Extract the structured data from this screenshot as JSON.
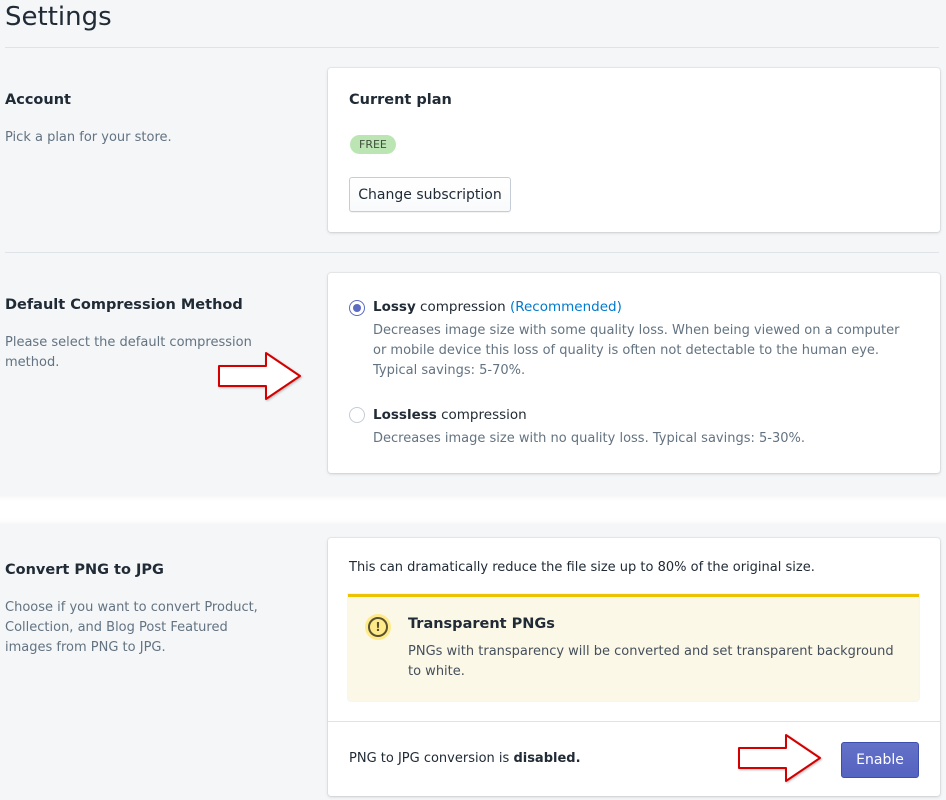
{
  "page": {
    "title": "Settings"
  },
  "account": {
    "title": "Account",
    "description": "Pick a plan for your store.",
    "card_heading": "Current plan",
    "plan_badge": "FREE",
    "change_button": "Change subscription"
  },
  "compression": {
    "title": "Default Compression Method",
    "description": "Please select the default compression method.",
    "options": [
      {
        "label_bold": "Lossy",
        "label_rest": " compression ",
        "tag": "(Recommended)",
        "help": "Decreases image size with some quality loss. When being viewed on a computer or mobile device this loss of quality is often not detectable to the human eye. Typical savings: 5-70%.",
        "checked": true
      },
      {
        "label_bold": "Lossless",
        "label_rest": " compression",
        "tag": "",
        "help": "Decreases image size with no quality loss. Typical savings: 5-30%.",
        "checked": false
      }
    ]
  },
  "png": {
    "title": "Convert PNG to JPG",
    "description": "Choose if you want to convert Product, Collection, and Blog Post Featured images from PNG to JPG.",
    "intro": "This can dramatically reduce the file size up to 80% of the original size.",
    "banner_title": "Transparent PNGs",
    "banner_body": "PNGs with transparency will be converted and set transparent background to white.",
    "banner_icon": "warning-icon",
    "banner_icon_glyph": "!",
    "status_prefix": "PNG to JPG conversion is ",
    "status_value": "disabled.",
    "enable_button": "Enable"
  },
  "colors": {
    "primary": "#5c6ac4",
    "badge_bg": "#bbe5b3",
    "banner_accent": "#eec200",
    "arrow": "#d40000"
  }
}
